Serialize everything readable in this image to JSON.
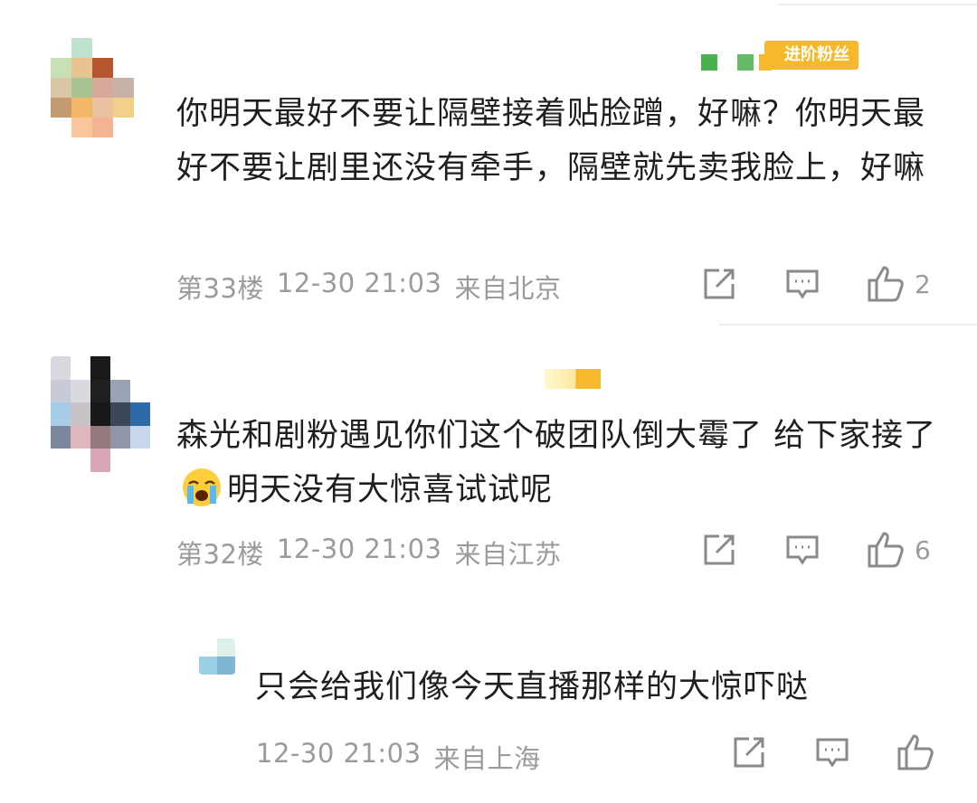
{
  "comments": [
    {
      "badge": "进阶粉丝",
      "text": "你明天最好不要让隔壁接着贴脸蹭，好嘛？你明天最好不要让剧里还没有牵手，隔壁就先卖我脸上，好嘛",
      "floor": "第33楼",
      "time": "12-30 21:03",
      "location": "来自北京",
      "likes": "2"
    },
    {
      "text_before": "森光和剧粉遇见你们这个破团队倒大霉了 给下家接了",
      "text_after": "明天没有大惊喜试试呢",
      "emoji": "crying-face-emoji",
      "floor": "第32楼",
      "time": "12-30 21:03",
      "location": "来自江苏",
      "likes": "6"
    },
    {
      "text": "只会给我们像今天直播那样的大惊吓哒",
      "time": "12-30 21:03",
      "location": "来自上海"
    }
  ],
  "icons": {
    "share": "share-icon",
    "comment": "comment-icon",
    "like": "like-icon"
  },
  "colors": {
    "badge": "#f6b92c",
    "meta_text": "#9b9b9b",
    "body_text": "#1f1f1f"
  }
}
